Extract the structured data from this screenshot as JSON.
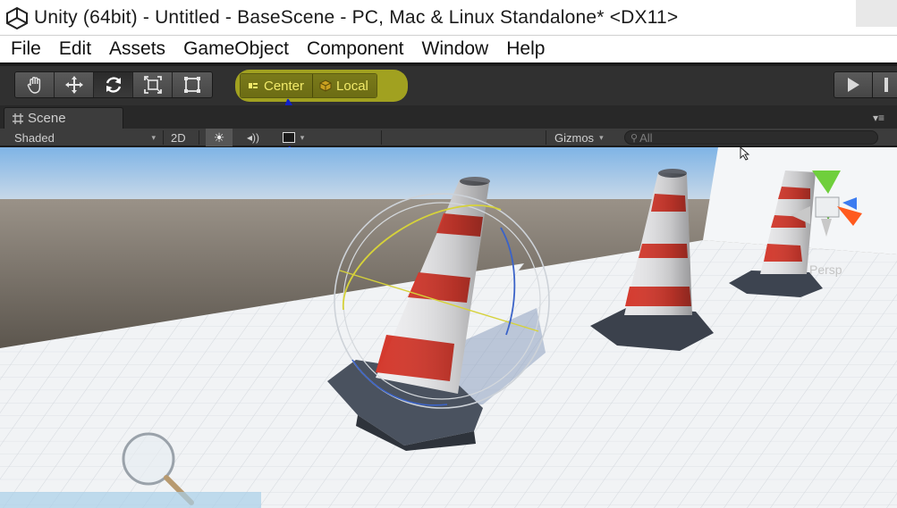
{
  "window": {
    "title": "Unity (64bit) - Untitled - BaseScene - PC, Mac & Linux Standalone* <DX11>"
  },
  "menu": [
    "File",
    "Edit",
    "Assets",
    "GameObject",
    "Component",
    "Window",
    "Help"
  ],
  "toolbar": {
    "transform_tools": [
      {
        "name": "hand-tool",
        "icon": "hand-icon"
      },
      {
        "name": "move-tool",
        "icon": "move-arrows-icon"
      },
      {
        "name": "rotate-tool",
        "icon": "rotate-icon",
        "active": true
      },
      {
        "name": "scale-tool",
        "icon": "scale-icon"
      },
      {
        "name": "rect-tool",
        "icon": "rect-icon"
      }
    ],
    "pivot_label": "Center",
    "rotation_label": "Local",
    "highlight_color": "#a8a820"
  },
  "scene_tab": {
    "label": "Scene"
  },
  "scene_controls": {
    "shading_mode": "Shaded",
    "mode_2d": "2D",
    "gizmos_label": "Gizmos",
    "search_placeholder": "All"
  },
  "viewport": {
    "projection_label": "Persp"
  }
}
